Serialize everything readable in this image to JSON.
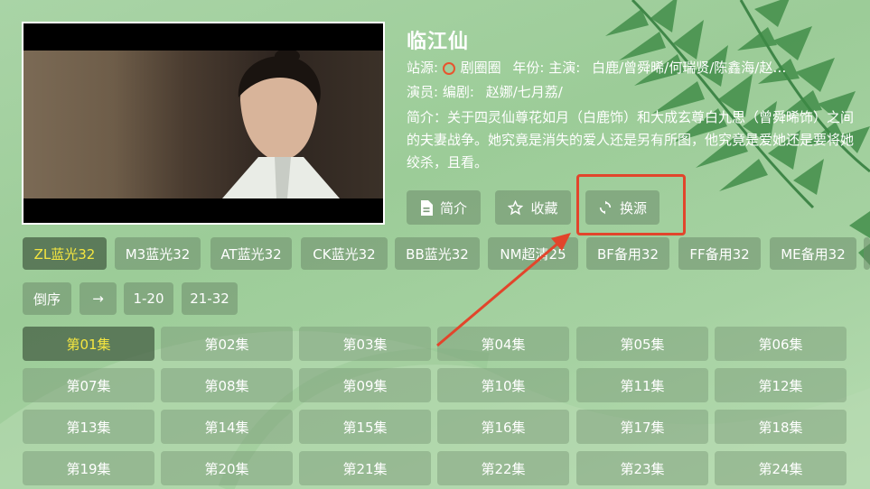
{
  "show": {
    "title": "临江仙",
    "source_label": "站源:",
    "source_name": "剧圈圈",
    "year_label": "年份:",
    "starring_label": "主演:",
    "starring": "白鹿/曾舜晞/何瑞贤/陈鑫海/赵…",
    "cast_label": "演员:",
    "writer_label": "编剧:",
    "writer": "赵娜/七月荔/",
    "description": "简介：关于四灵仙尊花如月（白鹿饰）和大成玄尊白九思（曾舜晞饰）之间的夫妻战争。她究竟是消失的爱人还是另有所图，他究竟是爱她还是要将她绞杀，且看。"
  },
  "actions": {
    "intro": {
      "label": "简介",
      "icon": "document-icon"
    },
    "favorite": {
      "label": "收藏",
      "icon": "star-icon"
    },
    "switch_source": {
      "label": "换源",
      "icon": "refresh-icon"
    }
  },
  "sources": [
    "ZL蓝光32",
    "M3蓝光32",
    "AT蓝光32",
    "CK蓝光32",
    "BB蓝光32",
    "NM超清25",
    "BF备用32",
    "FF备用32",
    "ME备用32"
  ],
  "controls": {
    "reverse": "倒序",
    "arrow": "→",
    "range1": "1-20",
    "range2": "21-32"
  },
  "episodes": [
    "第01集",
    "第02集",
    "第03集",
    "第04集",
    "第05集",
    "第06集",
    "第07集",
    "第08集",
    "第09集",
    "第10集",
    "第11集",
    "第12集",
    "第13集",
    "第14集",
    "第15集",
    "第16集",
    "第17集",
    "第18集",
    "第19集",
    "第20集",
    "第21集",
    "第22集",
    "第23集",
    "第24集"
  ],
  "colors": {
    "active_text": "#f5e640",
    "highlight": "#e2452b"
  }
}
